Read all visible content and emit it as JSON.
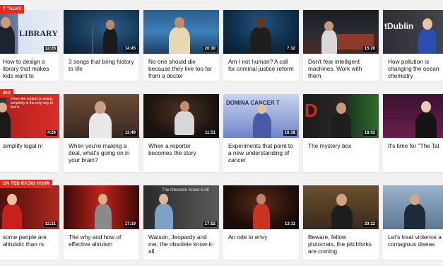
{
  "colors": {
    "accent": "#e62b1e",
    "background": "#f1f1f1"
  },
  "rows": [
    {
      "badge": "T TALKS",
      "cards": [
        {
          "title": "How to design a library that makes kids want to",
          "duration": "12:26",
          "overlay": "LIBRARY"
        },
        {
          "title": "3 songs that bring history to life",
          "duration": "14:45"
        },
        {
          "title": "No one should die because they live too far from a doctor",
          "duration": "20:30"
        },
        {
          "title": "Am I not human? A call for criminal justice reform",
          "duration": "7:32"
        },
        {
          "title": "Don't fear intelligent machines. Work with them",
          "duration": "15:20"
        },
        {
          "title": "How pollution is changing the ocean chemistry",
          "duration": "",
          "overlay": "tDublin"
        }
      ]
    },
    {
      "badge": "ING",
      "cards": [
        {
          "title": "simplify legal n!",
          "duration": "4:26",
          "overlay": "When the subject is wrong, simplicity is the only way to find it"
        },
        {
          "title": "When you're making a deal, what's going on in your brain?",
          "duration": "13:49"
        },
        {
          "title": "When a reporter becomes the story",
          "duration": "11:51"
        },
        {
          "title": "Experiments that point to a new understanding of cancer",
          "duration": "16:18",
          "overlay": "DOMINA  CANCER T"
        },
        {
          "title": "The mystery box",
          "duration": "18:02"
        },
        {
          "title": "It's time for \"The Tal",
          "duration": ""
        }
      ]
    },
    {
      "badge": "ON TED RADIO HOUR",
      "cards": [
        {
          "title": "some people are altruistic than rs",
          "duration": "12:21"
        },
        {
          "title": "The why and how of effective altruism",
          "duration": "17:19"
        },
        {
          "title": "Watson, Jeopardy and me, the obsolete know-it-all",
          "duration": "17:52",
          "overlay": "The Obsolete Know-It-All"
        },
        {
          "title": "An ode to envy",
          "duration": "13:11"
        },
        {
          "title": "Beware, fellow plutocrats, the pitchforks are coming",
          "duration": "20:22"
        },
        {
          "title": "Let's treat violence a contagious diseas",
          "duration": ""
        }
      ]
    }
  ]
}
